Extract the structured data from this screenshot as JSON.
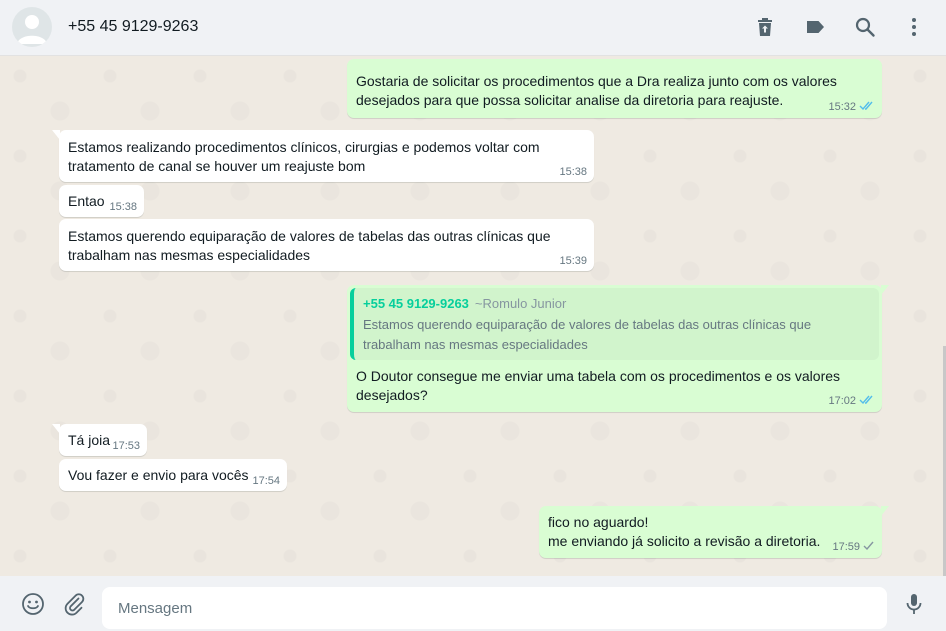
{
  "header": {
    "contact_name": "+55 45 9129-9263",
    "icons": [
      "delete-icon",
      "label-icon",
      "search-icon",
      "menu-icon"
    ]
  },
  "messages": [
    {
      "dir": "out",
      "text": "Gostaria de solicitar os procedimentos que a Dra realiza junto com os valores\ndesejados para que possa solicitar analise da diretoria para reajuste.",
      "time": "15:32",
      "status": "read"
    },
    {
      "dir": "in",
      "text": "Estamos realizando procedimentos clínicos, cirurgias e podemos voltar com\ntratamento de canal se houver um reajuste bom",
      "time": "15:38"
    },
    {
      "dir": "in",
      "text": "Entao",
      "time": "15:38"
    },
    {
      "dir": "in",
      "text": "Estamos querendo equiparação de valores de tabelas das outras clínicas que\ntrabalham nas mesmas especialidades",
      "time": "15:39"
    },
    {
      "dir": "out",
      "quote": {
        "author": "+55 45 9129-9263",
        "pushname": "~Romulo Junior",
        "text": "Estamos querendo equiparação de valores de tabelas das outras clínicas que\ntrabalham nas mesmas especialidades"
      },
      "text": "O Doutor consegue me enviar uma tabela com os procedimentos e os valores\ndesejados?",
      "time": "17:02",
      "status": "read"
    },
    {
      "dir": "in",
      "text": "Tá joia",
      "time": "17:53"
    },
    {
      "dir": "in",
      "text": "Vou fazer e envio para vocês",
      "time": "17:54"
    },
    {
      "dir": "out",
      "text": "fico no aguardo!\nme enviando já solicito a revisão a diretoria.",
      "time": "17:59",
      "status": "sent"
    }
  ],
  "footer": {
    "placeholder": "Mensagem",
    "icons": [
      "emoji-icon",
      "attach-icon",
      "microphone-icon"
    ]
  },
  "colors": {
    "incoming": "#ffffff",
    "outgoing": "#d9fdd3",
    "read_check": "#53bdeb",
    "quote_accent": "#06cf9c",
    "background": "#efeae2"
  }
}
